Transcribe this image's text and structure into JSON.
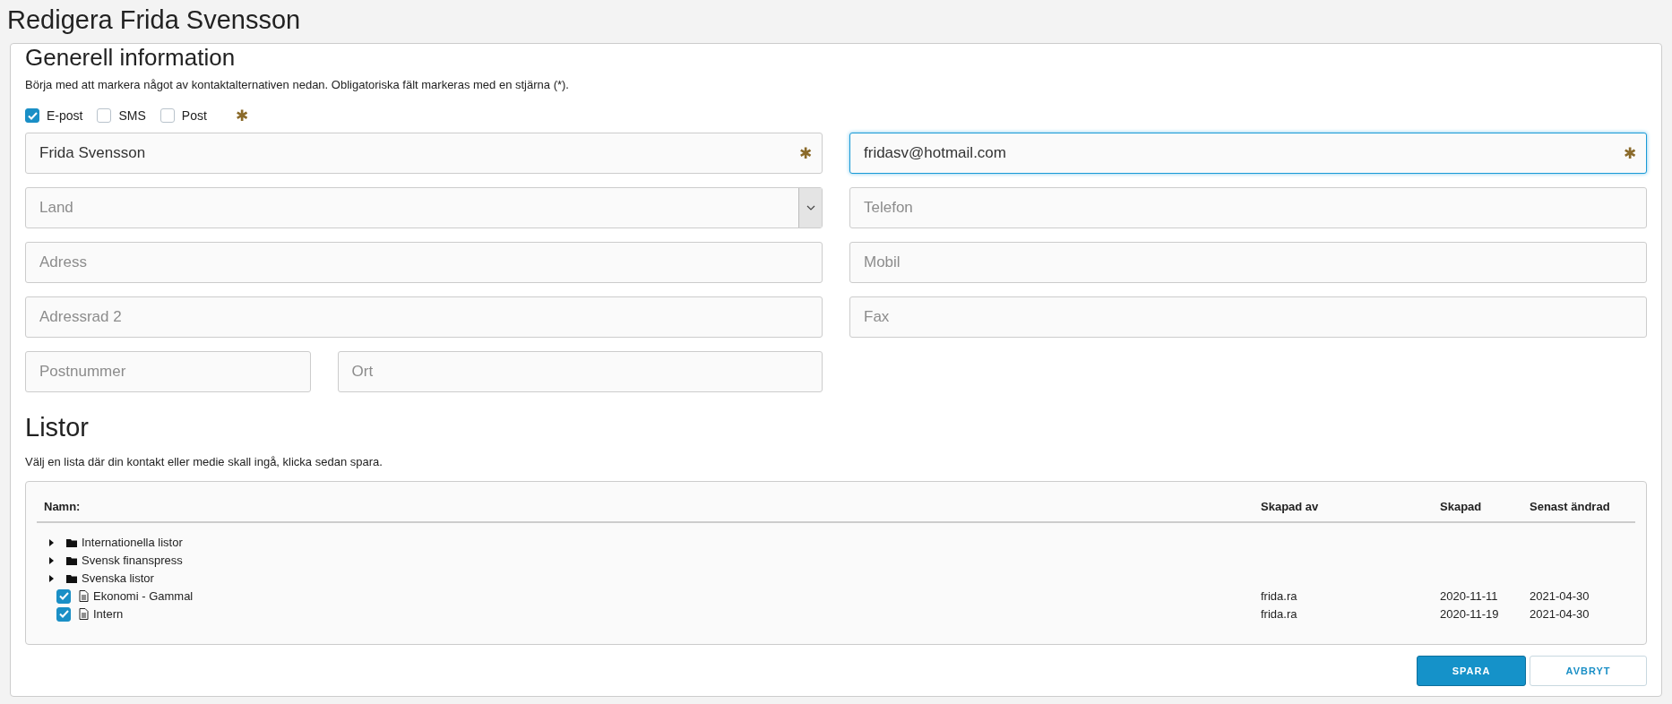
{
  "page_title": "Redigera Frida Svensson",
  "general": {
    "heading": "Generell information",
    "intro": "Börja med att markera något av kontaktalternativen nedan. Obligatoriska fält markeras med en stjärna (*).",
    "contact_options": [
      {
        "label": "E-post",
        "checked": true
      },
      {
        "label": "SMS",
        "checked": false
      },
      {
        "label": "Post",
        "checked": false
      }
    ],
    "required_marker": "✱",
    "fields": [
      {
        "kind": "input",
        "value": "Frida Svensson",
        "required": true
      },
      {
        "kind": "input",
        "value": "fridasv@hotmail.com",
        "required": true,
        "focused": true
      },
      {
        "kind": "select",
        "placeholder": "Land"
      },
      {
        "kind": "input",
        "placeholder": "Telefon"
      },
      {
        "kind": "input",
        "placeholder": "Adress"
      },
      {
        "kind": "input",
        "placeholder": "Mobil"
      },
      {
        "kind": "input",
        "placeholder": "Adressrad 2"
      },
      {
        "kind": "input",
        "placeholder": "Fax"
      },
      {
        "kind": "pair",
        "parts": [
          {
            "placeholder": "Postnummer"
          },
          {
            "placeholder": "Ort"
          }
        ]
      }
    ]
  },
  "lists": {
    "heading": "Listor",
    "intro": "Välj en lista där din kontakt eller medie skall ingå, klicka sedan spara.",
    "columns": [
      "Namn:",
      "Skapad av",
      "Skapad",
      "Senast ändrad"
    ],
    "rows": [
      {
        "kind": "folder",
        "name": "Internationella listor",
        "expanded": false
      },
      {
        "kind": "folder",
        "name": "Svensk finanspress",
        "expanded": false
      },
      {
        "kind": "folder",
        "name": "Svenska listor",
        "expanded": false
      },
      {
        "kind": "list",
        "name": "Ekonomi - Gammal",
        "checked": true,
        "created_by": "frida.ra",
        "created": "2020-11-11",
        "modified": "2021-04-30"
      },
      {
        "kind": "list",
        "name": "Intern",
        "checked": true,
        "created_by": "frida.ra",
        "created": "2020-11-19",
        "modified": "2021-04-30"
      }
    ]
  },
  "buttons": [
    {
      "kind": "primary",
      "label": "SPARA"
    },
    {
      "kind": "secondary",
      "label": "AVBRYT"
    }
  ]
}
